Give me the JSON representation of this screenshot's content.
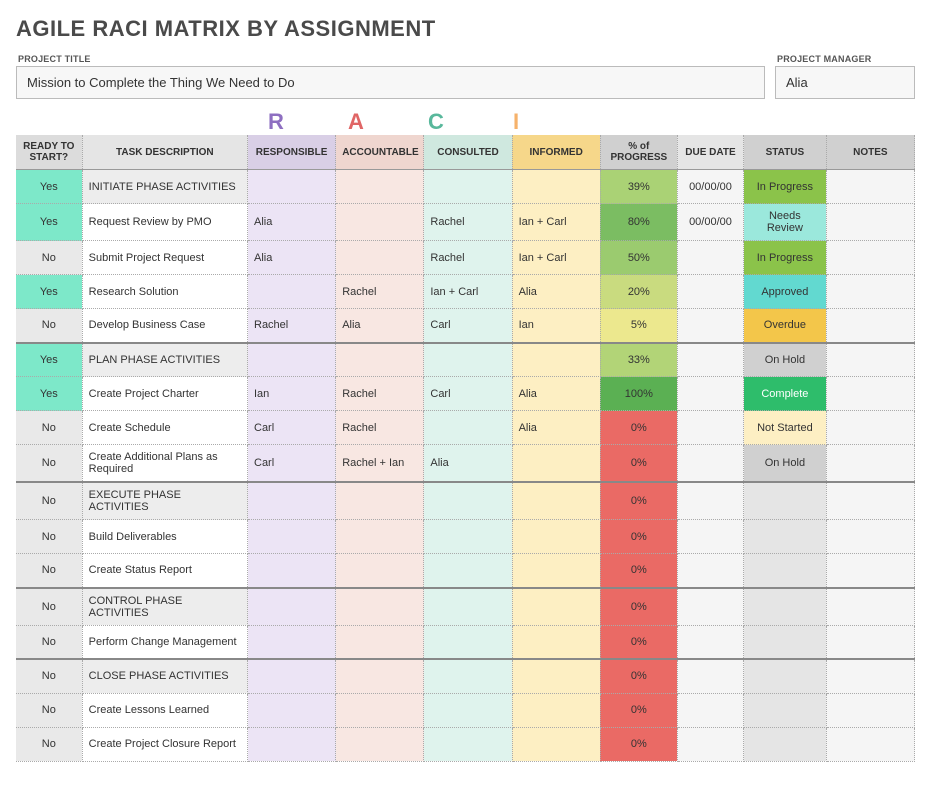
{
  "title": "AGILE RACI MATRIX BY ASSIGNMENT",
  "meta": {
    "project_label": "PROJECT TITLE",
    "project_value": "Mission to Complete the Thing We Need to Do",
    "manager_label": "PROJECT MANAGER",
    "manager_value": "Alia"
  },
  "raci_letters": {
    "r": "R",
    "a": "A",
    "c": "C",
    "i": "I"
  },
  "headers": {
    "ready": "READY TO START?",
    "desc": "TASK DESCRIPTION",
    "resp": "RESPONSIBLE",
    "acct": "ACCOUNTABLE",
    "cons": "CONSULTED",
    "info": "INFORMED",
    "prog": "% of PROGRESS",
    "due": "DUE DATE",
    "stat": "STATUS",
    "notes": "NOTES"
  },
  "rows": [
    {
      "phase": true,
      "section_start": false,
      "ready": "Yes",
      "desc": "INITIATE PHASE ACTIVITIES",
      "resp": "",
      "acct": "",
      "cons": "",
      "info": "",
      "prog": "39%",
      "prog_cls": "pg-39",
      "due": "00/00/00",
      "stat": "In Progress",
      "stat_cls": "st-inprogress"
    },
    {
      "phase": false,
      "section_start": false,
      "ready": "Yes",
      "desc": "Request Review by PMO",
      "resp": "Alia",
      "acct": "",
      "cons": "Rachel",
      "info": "Ian + Carl",
      "prog": "80%",
      "prog_cls": "pg-80",
      "due": "00/00/00",
      "stat": "Needs Review",
      "stat_cls": "st-needsreview"
    },
    {
      "phase": false,
      "section_start": false,
      "ready": "No",
      "desc": "Submit Project Request",
      "resp": "Alia",
      "acct": "",
      "cons": "Rachel",
      "info": "Ian + Carl",
      "prog": "50%",
      "prog_cls": "pg-50",
      "due": "",
      "stat": "In Progress",
      "stat_cls": "st-inprogress"
    },
    {
      "phase": false,
      "section_start": false,
      "ready": "Yes",
      "desc": "Research Solution",
      "resp": "",
      "acct": "Rachel",
      "cons": "Ian + Carl",
      "info": "Alia",
      "prog": "20%",
      "prog_cls": "pg-20",
      "due": "",
      "stat": "Approved",
      "stat_cls": "st-approved"
    },
    {
      "phase": false,
      "section_start": false,
      "ready": "No",
      "desc": "Develop Business Case",
      "resp": "Rachel",
      "acct": "Alia",
      "cons": "Carl",
      "info": "Ian",
      "prog": "5%",
      "prog_cls": "pg-5",
      "due": "",
      "stat": "Overdue",
      "stat_cls": "st-overdue"
    },
    {
      "phase": true,
      "section_start": true,
      "ready": "Yes",
      "desc": "PLAN PHASE ACTIVITIES",
      "resp": "",
      "acct": "",
      "cons": "",
      "info": "",
      "prog": "33%",
      "prog_cls": "pg-33",
      "due": "",
      "stat": "On Hold",
      "stat_cls": "st-onhold"
    },
    {
      "phase": false,
      "section_start": false,
      "ready": "Yes",
      "desc": "Create Project Charter",
      "resp": "Ian",
      "acct": "Rachel",
      "cons": "Carl",
      "info": "Alia",
      "prog": "100%",
      "prog_cls": "pg-100",
      "due": "",
      "stat": "Complete",
      "stat_cls": "st-complete"
    },
    {
      "phase": false,
      "section_start": false,
      "ready": "No",
      "desc": "Create Schedule",
      "resp": "Carl",
      "acct": "Rachel",
      "cons": "",
      "info": "Alia",
      "prog": "0%",
      "prog_cls": "pg-0",
      "due": "",
      "stat": "Not Started",
      "stat_cls": "st-notstarted"
    },
    {
      "phase": false,
      "section_start": false,
      "ready": "No",
      "desc": "Create Additional Plans as Required",
      "resp": "Carl",
      "acct": "Rachel + Ian",
      "cons": "Alia",
      "info": "",
      "prog": "0%",
      "prog_cls": "pg-0",
      "due": "",
      "stat": "On Hold",
      "stat_cls": "st-onhold"
    },
    {
      "phase": true,
      "section_start": true,
      "ready": "No",
      "desc": "EXECUTE PHASE ACTIVITIES",
      "resp": "",
      "acct": "",
      "cons": "",
      "info": "",
      "prog": "0%",
      "prog_cls": "pg-0",
      "due": "",
      "stat": "",
      "stat_cls": "st-none"
    },
    {
      "phase": false,
      "section_start": false,
      "ready": "No",
      "desc": "Build Deliverables",
      "resp": "",
      "acct": "",
      "cons": "",
      "info": "",
      "prog": "0%",
      "prog_cls": "pg-0",
      "due": "",
      "stat": "",
      "stat_cls": "st-none"
    },
    {
      "phase": false,
      "section_start": false,
      "ready": "No",
      "desc": "Create Status Report",
      "resp": "",
      "acct": "",
      "cons": "",
      "info": "",
      "prog": "0%",
      "prog_cls": "pg-0",
      "due": "",
      "stat": "",
      "stat_cls": "st-none"
    },
    {
      "phase": true,
      "section_start": true,
      "ready": "No",
      "desc": "CONTROL PHASE ACTIVITIES",
      "resp": "",
      "acct": "",
      "cons": "",
      "info": "",
      "prog": "0%",
      "prog_cls": "pg-0",
      "due": "",
      "stat": "",
      "stat_cls": "st-none"
    },
    {
      "phase": false,
      "section_start": false,
      "ready": "No",
      "desc": "Perform Change Management",
      "resp": "",
      "acct": "",
      "cons": "",
      "info": "",
      "prog": "0%",
      "prog_cls": "pg-0",
      "due": "",
      "stat": "",
      "stat_cls": "st-none"
    },
    {
      "phase": true,
      "section_start": true,
      "ready": "No",
      "desc": "CLOSE PHASE ACTIVITIES",
      "resp": "",
      "acct": "",
      "cons": "",
      "info": "",
      "prog": "0%",
      "prog_cls": "pg-0",
      "due": "",
      "stat": "",
      "stat_cls": "st-none"
    },
    {
      "phase": false,
      "section_start": false,
      "ready": "No",
      "desc": "Create Lessons Learned",
      "resp": "",
      "acct": "",
      "cons": "",
      "info": "",
      "prog": "0%",
      "prog_cls": "pg-0",
      "due": "",
      "stat": "",
      "stat_cls": "st-none"
    },
    {
      "phase": false,
      "section_start": false,
      "ready": "No",
      "desc": "Create Project Closure Report",
      "resp": "",
      "acct": "",
      "cons": "",
      "info": "",
      "prog": "0%",
      "prog_cls": "pg-0",
      "due": "",
      "stat": "",
      "stat_cls": "st-none"
    }
  ]
}
